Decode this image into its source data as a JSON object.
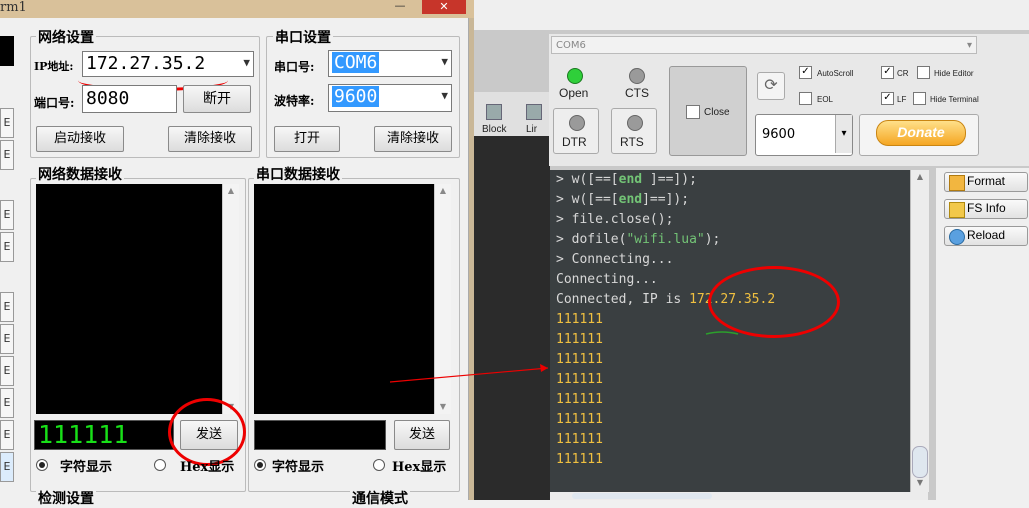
{
  "form": {
    "title": "rm1",
    "minimize_glyph": "—",
    "close_glyph": "✕",
    "network_group": {
      "title": "网络设置",
      "ip_label": "IP地址:",
      "ip_value": "172.27.35.2",
      "port_label": "端口号:",
      "port_value": "8080",
      "disconnect_button": "断开",
      "start_receive_button": "启动接收",
      "clear_receive_button": "清除接收"
    },
    "serial_group": {
      "title": "串口设置",
      "port_label": "串口号:",
      "port_value": "COM6",
      "baud_label": "波特率:",
      "baud_value": "9600",
      "open_button": "打开",
      "clear_receive_button": "清除接收"
    },
    "network_recv": {
      "title": "网络数据接收",
      "send_text": "111111",
      "send_button": "发送",
      "radio_char": "字符显示",
      "radio_hex": "Hex显示"
    },
    "serial_recv": {
      "title": "串口数据接收",
      "send_text": "",
      "send_button": "发送",
      "radio_char": "字符显示",
      "radio_hex": "Hex显示"
    },
    "bottom_groups": {
      "left": "检测设置",
      "right": "通信模式"
    },
    "side_buttons": [
      "E",
      "E",
      "E",
      "E",
      "E",
      "E",
      "E",
      "E",
      "E",
      "E",
      "E"
    ]
  },
  "esp": {
    "port_select": "COM6",
    "open_label": "Open",
    "cts_label": "CTS",
    "dtr_label": "DTR",
    "rts_label": "RTS",
    "close_label": "Close",
    "baud_value": "9600",
    "donate_label": "Donate",
    "autoscroll_label": "AutoScroll",
    "eol_label": "EOL",
    "cr_label": "CR",
    "lf_label": "LF",
    "hide_editor_label": "Hide Editor",
    "hide_terminal_label": "Hide Terminal",
    "block_label": "Block",
    "lin_label": "Lir",
    "checkbox_checked": "✓",
    "dropdown_glyph": "▾",
    "refresh_glyph": "⟳",
    "led_colors": {
      "open": "#2fcf3a",
      "cts": "#9a9a9a",
      "dtr": "#9a9a9a",
      "rts": "#9a9a9a"
    },
    "terminal": {
      "lines": [
        {
          "parts": [
            {
              "t": "> w([==[",
              "c": ""
            },
            {
              "t": "end",
              "c": "kw"
            },
            {
              "t": " ]==]);",
              "c": ""
            }
          ]
        },
        {
          "parts": [
            {
              "t": "> w([==[",
              "c": ""
            },
            {
              "t": "end",
              "c": "kw"
            },
            {
              "t": "]==]);",
              "c": ""
            }
          ]
        },
        {
          "parts": [
            {
              "t": "> file.close();",
              "c": ""
            }
          ]
        },
        {
          "parts": [
            {
              "t": "> dofile(",
              "c": ""
            },
            {
              "t": "\"wifi.lua\"",
              "c": "str"
            },
            {
              "t": ");",
              "c": ""
            }
          ]
        },
        {
          "parts": [
            {
              "t": "> Connecting...",
              "c": ""
            }
          ]
        },
        {
          "parts": [
            {
              "t": "Connecting...",
              "c": ""
            }
          ]
        },
        {
          "parts": [
            {
              "t": "Connected, IP is ",
              "c": ""
            },
            {
              "t": "172.27.35.2",
              "c": "yel"
            }
          ]
        },
        {
          "parts": [
            {
              "t": "111111",
              "c": "yel"
            }
          ]
        },
        {
          "parts": [
            {
              "t": "111111",
              "c": "yel"
            }
          ]
        },
        {
          "parts": [
            {
              "t": "111111",
              "c": "yel"
            }
          ]
        },
        {
          "parts": [
            {
              "t": "111111",
              "c": "yel"
            }
          ]
        },
        {
          "parts": [
            {
              "t": "111111",
              "c": "yel"
            }
          ]
        },
        {
          "parts": [
            {
              "t": "111111",
              "c": "yel"
            }
          ]
        },
        {
          "parts": [
            {
              "t": "111111",
              "c": "yel"
            }
          ]
        },
        {
          "parts": [
            {
              "t": "111111",
              "c": "yel"
            }
          ]
        }
      ]
    },
    "side": {
      "format": "Format",
      "fsinfo": "FS Info",
      "reload": "Reload"
    }
  }
}
